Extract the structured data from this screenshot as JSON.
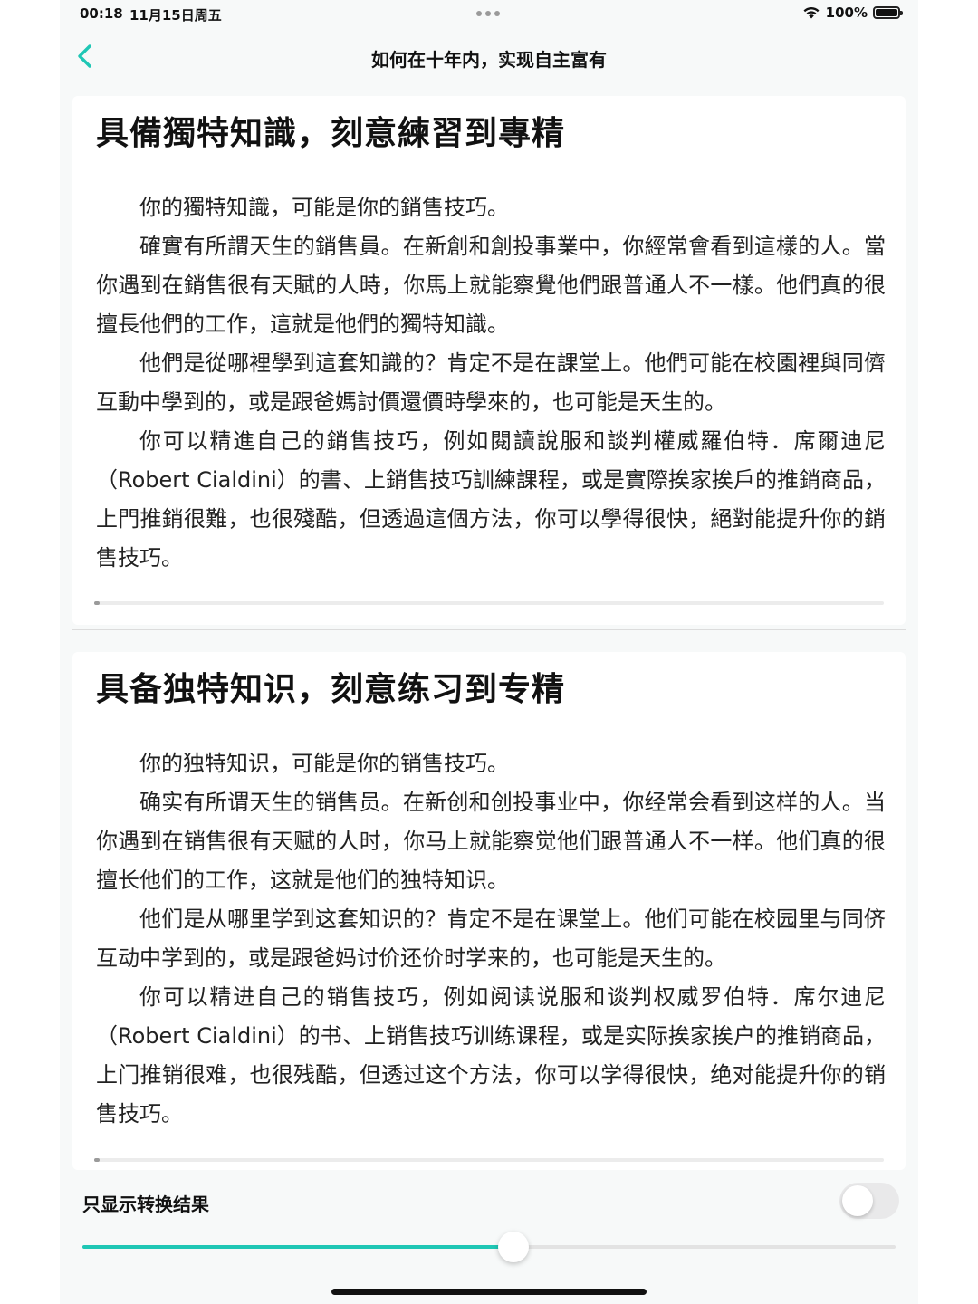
{
  "status_bar": {
    "time": "00:18",
    "date": "11月15日周五",
    "battery": "100%"
  },
  "nav": {
    "title": "如何在十年内，实现自主富有",
    "back_icon": "chevron-left-icon",
    "accent_color": "#1fc7b5"
  },
  "traditional": {
    "title": "具備獨特知識，刻意練習到專精",
    "paragraphs": [
      "你的獨特知識，可能是你的銷售技巧。",
      "確實有所謂天生的銷售員。在新創和創投事業中，你經常會看到這樣的人。當你遇到在銷售很有天賦的人時，你馬上就能察覺他們跟普通人不一樣。他們真的很擅長他們的工作，這就是他們的獨特知識。",
      "他們是從哪裡學到這套知識的？肯定不是在課堂上。他們可能在校園裡與同儕互動中學到的，或是跟爸媽討價還價時學來的，也可能是天生的。",
      "你可以精進自己的銷售技巧，例如閱讀說服和談判權威羅伯特．席爾迪尼（Robert Cialdini）的書、上銷售技巧訓練課程，或是實際挨家挨戶的推銷商品，上門推銷很難，也很殘酷，但透過這個方法，你可以學得很快，絕對能提升你的銷售技巧。"
    ]
  },
  "simplified": {
    "title": "具备独特知识，刻意练习到专精",
    "paragraphs": [
      "你的独特知识，可能是你的销售技巧。",
      "确实有所谓天生的销售员。在新创和创投事业中，你经常会看到这样的人。当你遇到在销售很有天赋的人时，你马上就能察觉他们跟普通人不一样。他们真的很擅长他们的工作，这就是他们的独特知识。",
      "他们是从哪里学到这套知识的？肯定不是在课堂上。他们可能在校园里与同侪互动中学到的，或是跟爸妈讨价还价时学来的，也可能是天生的。",
      "你可以精进自己的销售技巧，例如阅读说服和谈判权威罗伯特．席尔迪尼（Robert Cialdini）的书、上销售技巧训练课程，或是实际挨家挨户的推销商品，上门推销很难，也很残酷，但透过这个方法，你可以学得很快，绝对能提升你的销售技巧。"
    ]
  },
  "controls": {
    "toggle_label": "只显示转换结果",
    "toggle_on": false,
    "slider_value": 0.53
  }
}
